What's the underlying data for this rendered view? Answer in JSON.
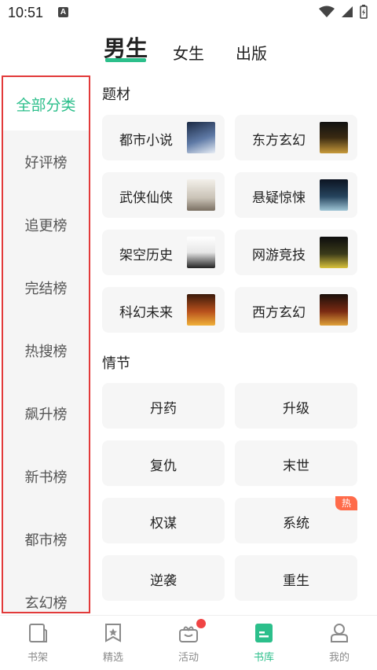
{
  "status_bar": {
    "time": "10:51",
    "notification_icon_letter": "A"
  },
  "top_tabs": [
    {
      "label": "男生",
      "active": true
    },
    {
      "label": "女生",
      "active": false
    },
    {
      "label": "出版",
      "active": false
    }
  ],
  "sidebar": {
    "items": [
      {
        "label": "全部分类",
        "active": true
      },
      {
        "label": "好评榜"
      },
      {
        "label": "追更榜"
      },
      {
        "label": "完结榜"
      },
      {
        "label": "热搜榜"
      },
      {
        "label": "飙升榜"
      },
      {
        "label": "新书榜"
      },
      {
        "label": "都市榜"
      },
      {
        "label": "玄幻榜"
      }
    ]
  },
  "main": {
    "genre_title": "题材",
    "genres": [
      {
        "label": "都市小说",
        "icon": "book-cover-urban"
      },
      {
        "label": "东方玄幻",
        "icon": "book-cover-fantasy"
      },
      {
        "label": "武侠仙侠",
        "icon": "book-cover-wuxia"
      },
      {
        "label": "悬疑惊悚",
        "icon": "book-cover-thriller"
      },
      {
        "label": "架空历史",
        "icon": "book-cover-history"
      },
      {
        "label": "网游竞技",
        "icon": "book-cover-gaming"
      },
      {
        "label": "科幻未来",
        "icon": "book-cover-scifi"
      },
      {
        "label": "西方玄幻",
        "icon": "book-cover-western"
      }
    ],
    "plot_title": "情节",
    "plots": [
      {
        "label": "丹药"
      },
      {
        "label": "升级"
      },
      {
        "label": "复仇"
      },
      {
        "label": "末世"
      },
      {
        "label": "权谋"
      },
      {
        "label": "系统",
        "badge": "热"
      },
      {
        "label": "逆袭"
      },
      {
        "label": "重生"
      }
    ]
  },
  "bottom_nav": [
    {
      "label": "书架",
      "icon": "bookshelf-icon"
    },
    {
      "label": "精选",
      "icon": "featured-icon"
    },
    {
      "label": "活动",
      "icon": "gift-icon",
      "dot": true
    },
    {
      "label": "书库",
      "icon": "library-icon",
      "active": true
    },
    {
      "label": "我的",
      "icon": "profile-icon"
    }
  ],
  "colors": {
    "accent": "#2cbf8b",
    "sidebar_bg": "#f5f5f5",
    "card_bg": "#f6f6f6",
    "highlight_border": "#e23a3a",
    "badge": "#ff6b4a",
    "dot": "#f04444"
  }
}
